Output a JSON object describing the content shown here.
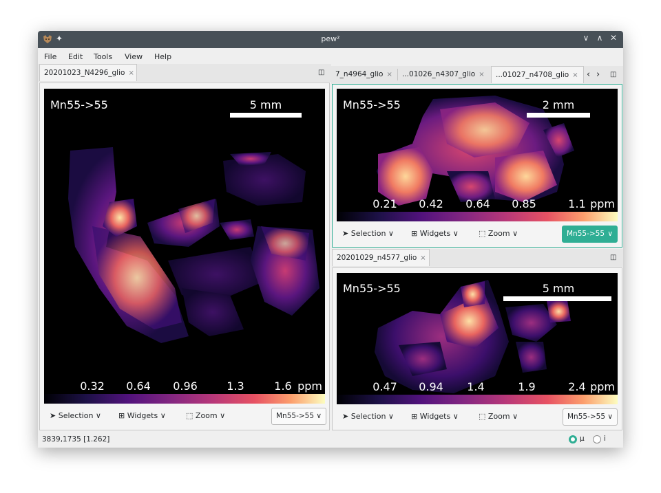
{
  "window": {
    "title": "pew²",
    "controls": {
      "minimize": "∨",
      "maximize": "∧",
      "close": "✕"
    }
  },
  "menu": [
    "File",
    "Edit",
    "Tools",
    "View",
    "Help"
  ],
  "left_group": {
    "tabs": [
      {
        "label": "20201023_N4296_glio",
        "close": "×"
      }
    ],
    "split_icon": "◫",
    "image": {
      "element": "Mn55->55",
      "scale_label": "5 mm",
      "unit": "ppm",
      "colorbar_ticks": [
        "0.32",
        "0.64",
        "0.96",
        "1.3",
        "1.6"
      ]
    },
    "toolbar": {
      "selection": "Selection",
      "widgets": "Widgets",
      "zoom": "Zoom",
      "element_select": "Mn55->55"
    }
  },
  "top_right_group": {
    "tabs": [
      {
        "label": "7_n4964_glio",
        "close": "×"
      },
      {
        "label": "...01026_n4307_glio",
        "close": "×"
      },
      {
        "label": "...01027_n4708_glio",
        "close": "×"
      }
    ],
    "nav": {
      "prev": "‹",
      "next": "›"
    },
    "split_icon": "◫",
    "image": {
      "element": "Mn55->55",
      "scale_label": "2 mm",
      "unit": "ppm",
      "colorbar_ticks": [
        "0.21",
        "0.42",
        "0.64",
        "0.85",
        "1.1"
      ]
    },
    "toolbar": {
      "selection": "Selection",
      "widgets": "Widgets",
      "zoom": "Zoom",
      "element_select": "Mn55->55"
    }
  },
  "bottom_right_group": {
    "tabs": [
      {
        "label": "20201029_n4577_glio",
        "close": "×"
      }
    ],
    "split_icon": "◫",
    "image": {
      "element": "Mn55->55",
      "scale_label": "5 mm",
      "unit": "ppm",
      "colorbar_ticks": [
        "0.47",
        "0.94",
        "1.4",
        "1.9",
        "2.4"
      ]
    },
    "toolbar": {
      "selection": "Selection",
      "widgets": "Widgets",
      "zoom": "Zoom",
      "element_select": "Mn55->55"
    }
  },
  "status": {
    "coordinates": "3839,1735 [1.262]",
    "units": {
      "micro": "μ",
      "pixel": "i",
      "selected": "micro"
    }
  },
  "colors": {
    "accent": "#2fae94",
    "titlebar": "#475057",
    "colormap": "magma"
  }
}
